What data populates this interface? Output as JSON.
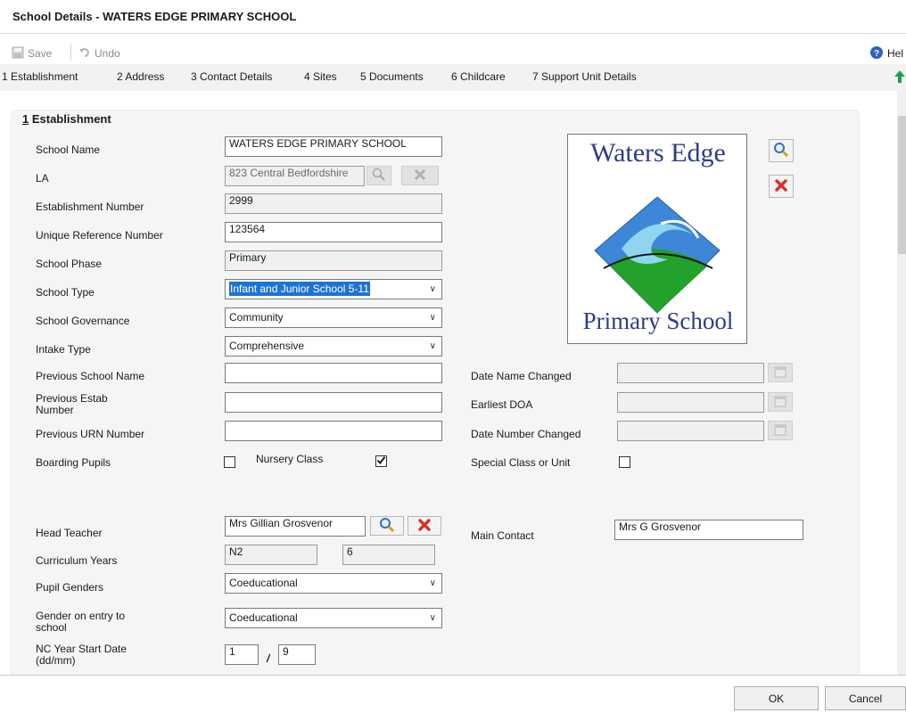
{
  "window": {
    "title": "School Details - WATERS EDGE PRIMARY SCHOOL"
  },
  "toolbar": {
    "save_label": "Save",
    "undo_label": "Undo",
    "help_label": "Hel"
  },
  "nav": {
    "tabs": [
      {
        "label": "1 Establishment"
      },
      {
        "label": "2 Address"
      },
      {
        "label": "3 Contact Details"
      },
      {
        "label": "4 Sites"
      },
      {
        "label": "5 Documents"
      },
      {
        "label": "6 Childcare"
      },
      {
        "label": "7 Support Unit Details"
      }
    ]
  },
  "section": {
    "number": "1",
    "title": " Establishment"
  },
  "form": {
    "school_name_label": "School Name",
    "school_name": "WATERS EDGE PRIMARY SCHOOL",
    "la_label": "LA",
    "la": "823 Central Bedfordshire",
    "establishment_number_label": "Establishment Number",
    "establishment_number": "2999",
    "urn_label": "Unique Reference Number",
    "urn": "123564",
    "phase_label": "School Phase",
    "phase": "Primary",
    "type_label": "School Type",
    "type": "Infant and Junior School 5-11",
    "governance_label": "School Governance",
    "governance": "Community",
    "intake_label": "Intake Type",
    "intake": "Comprehensive",
    "prev_name_label": "Previous School Name",
    "prev_name": "",
    "prev_estab_label": "Previous Estab Number",
    "prev_estab": "",
    "prev_urn_label": "Previous URN Number",
    "prev_urn": "",
    "boarding_label": "Boarding Pupils",
    "boarding_checked": false,
    "nursery_label": "Nursery Class",
    "nursery_checked": true,
    "date_name_changed_label": "Date Name Changed",
    "date_name_changed": "",
    "earliest_doa_label": "Earliest DOA",
    "earliest_doa": "",
    "date_number_changed_label": "Date Number Changed",
    "date_number_changed": "",
    "special_class_label": "Special Class or Unit",
    "special_class_checked": false,
    "head_teacher_label": "Head Teacher",
    "head_teacher": "Mrs Gillian Grosvenor",
    "main_contact_label": "Main Contact",
    "main_contact": "Mrs G Grosvenor",
    "curriculum_years_label": "Curriculum Years",
    "curriculum_from": "N2",
    "curriculum_to": "6",
    "pupil_genders_label": "Pupil Genders",
    "pupil_genders": "Coeducational",
    "gender_entry_label": "Gender on entry to school",
    "gender_entry": "Coeducational",
    "nc_start_label": "NC Year Start Date (dd/mm)",
    "nc_day": "1",
    "nc_sep": "/",
    "nc_month": "9"
  },
  "logo": {
    "top_text": "Waters Edge",
    "bottom_text": "Primary School"
  },
  "footer": {
    "ok_label": "OK",
    "cancel_label": "Cancel"
  },
  "colors": {
    "accent": "#1e73d2",
    "delete": "#d9302c",
    "panel": "#f5f5f5"
  }
}
